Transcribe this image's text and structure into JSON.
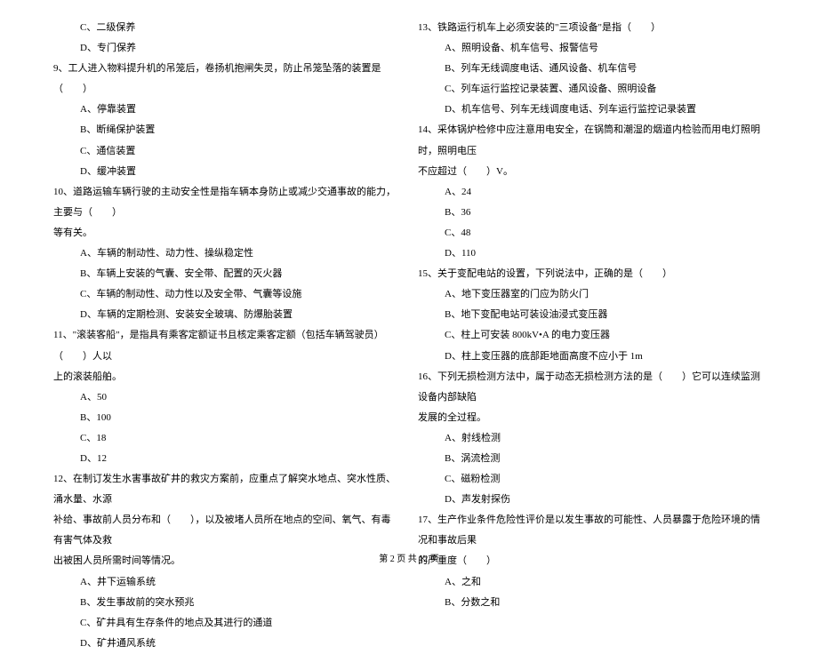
{
  "left": {
    "opts8a": "C、二级保养",
    "opts8b": "D、专门保养",
    "q9": "9、工人进入物料提升机的吊笼后，卷扬机抱闸失灵，防止吊笼坠落的装置是（　　）",
    "opts9": [
      "A、停靠装置",
      "B、断绳保护装置",
      "C、通信装置",
      "D、缓冲装置"
    ],
    "q10a": "10、道路运输车辆行驶的主动安全性是指车辆本身防止或减少交通事故的能力，主要与（　　）",
    "q10b": "等有关。",
    "opts10": [
      "A、车辆的制动性、动力性、操纵稳定性",
      "B、车辆上安装的气囊、安全带、配置的灭火器",
      "C、车辆的制动性、动力性以及安全带、气囊等设施",
      "D、车辆的定期检测、安装安全玻璃、防爆胎装置"
    ],
    "q11a": "11、\"滚装客船\"，是指具有乘客定额证书且核定乘客定额（包括车辆驾驶员）（　　）人以",
    "q11b": "上的滚装船舶。",
    "opts11": [
      "A、50",
      "B、100",
      "C、18",
      "D、12"
    ],
    "q12a": "12、在制订发生水害事故矿井的救灾方案前，应重点了解突水地点、突水性质、涌水量、水源",
    "q12b": "补给、事故前人员分布和（　　），以及被堵人员所在地点的空间、氧气、有毒有害气体及救",
    "q12c": "出被困人员所需时间等情况。",
    "opts12": [
      "A、井下运输系统",
      "B、发生事故前的突水预兆",
      "C、矿井具有生存条件的地点及其进行的通道",
      "D、矿井通风系统"
    ]
  },
  "right": {
    "q13": "13、铁路运行机车上必须安装的\"三项设备\"是指（　　）",
    "opts13": [
      "A、照明设备、机车信号、报警信号",
      "B、列车无线调度电话、通风设备、机车信号",
      "C、列车运行监控记录装置、通风设备、照明设备",
      "D、机车信号、列车无线调度电话、列车运行监控记录装置"
    ],
    "q14a": "14、采体锅炉检修中应注意用电安全，在锅筒和潮湿的烟道内检验而用电灯照明时，照明电压",
    "q14b": "不应超过（　　）V。",
    "opts14": [
      "A、24",
      "B、36",
      "C、48",
      "D、110"
    ],
    "q15": "15、关于变配电站的设置，下列说法中，正确的是（　　）",
    "opts15": [
      "A、地下变压器室的门应为防火门",
      "B、地下变配电站可装设油浸式变压器",
      "C、柱上可安装 800kV•A 的电力变压器",
      "D、柱上变压器的底部距地面高度不应小于 1m"
    ],
    "q16a": "16、下列无损检测方法中，属于动态无损检测方法的是（　　）它可以连续监测设备内部缺陷",
    "q16b": "发展的全过程。",
    "opts16": [
      "A、射线检测",
      "B、涡流检测",
      "C、磁粉检测",
      "D、声发射探伤"
    ],
    "q17a": "17、生产作业条件危险性评价是以发生事故的可能性、人员暴露于危险环境的情况和事故后果",
    "q17b": "的严重度（　　）",
    "opts17": [
      "A、之和",
      "B、分数之和"
    ]
  },
  "footer": "第 2 页 共 12 页"
}
